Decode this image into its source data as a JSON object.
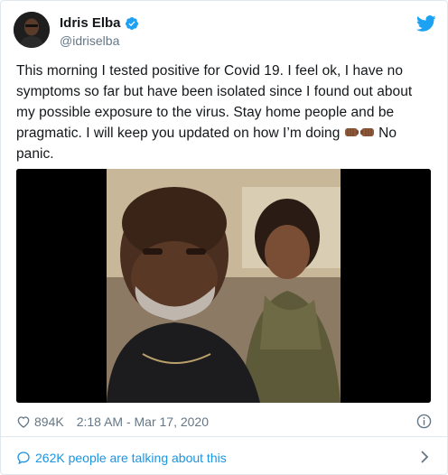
{
  "tweet": {
    "author": {
      "name": "Idris Elba",
      "handle": "@idriselba",
      "verified": true
    },
    "text_main": "This morning I tested positive for Covid 19. I feel ok, I have no symptoms so far but have been isolated since I found out about my possible exposure to the virus.  Stay home people and be pragmatic. I will keep you updated on how I’m doing",
    "text_tail": "No panic.",
    "emoji": [
      "fist-bump-left",
      "fist-bump-right"
    ],
    "likes": "894K",
    "timestamp": "2:18 AM - Mar 17, 2020",
    "talking": "262K people are talking about this"
  },
  "colors": {
    "brand_blue": "#1da1f2",
    "link_blue": "#1b95e0",
    "text": "#14171a",
    "muted": "#657786",
    "border": "#e1e8ed"
  },
  "icons": [
    "twitter-bird-icon",
    "verified-badge-icon",
    "heart-icon",
    "info-icon",
    "speech-bubble-icon",
    "chevron-right-icon"
  ]
}
